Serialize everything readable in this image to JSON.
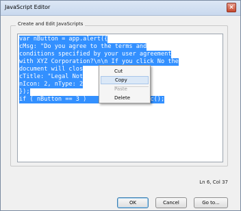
{
  "window": {
    "title": "JavaScript Editor",
    "close_glyph": "×"
  },
  "group": {
    "legend": "Create and Edit JavaScripts"
  },
  "editor": {
    "lines": [
      "var nButton = app.alert({",
      "cMsg: \"Do you agree to the terms and",
      "conditions specified by your user agreement",
      "with XYZ Corporation?\\n\\n If you click No the",
      "document will clos",
      "cTitle: \"Legal Not",
      "nIcon: 2, nType: 2",
      "});",
      "if ( nButton == 3 )                Doc();"
    ]
  },
  "context_menu": {
    "items": [
      {
        "label": "Cut",
        "enabled": true
      },
      {
        "label": "Copy",
        "enabled": true
      },
      {
        "label": "Paste",
        "enabled": false
      },
      {
        "label": "Delete",
        "enabled": true
      }
    ]
  },
  "status": {
    "position": "Ln 6, Col 37"
  },
  "buttons": {
    "ok": "OK",
    "cancel": "Cancel",
    "goto": "Go to..."
  },
  "colors": {
    "selection": "#3390ff",
    "menu_hover": "#dbe8f7"
  }
}
